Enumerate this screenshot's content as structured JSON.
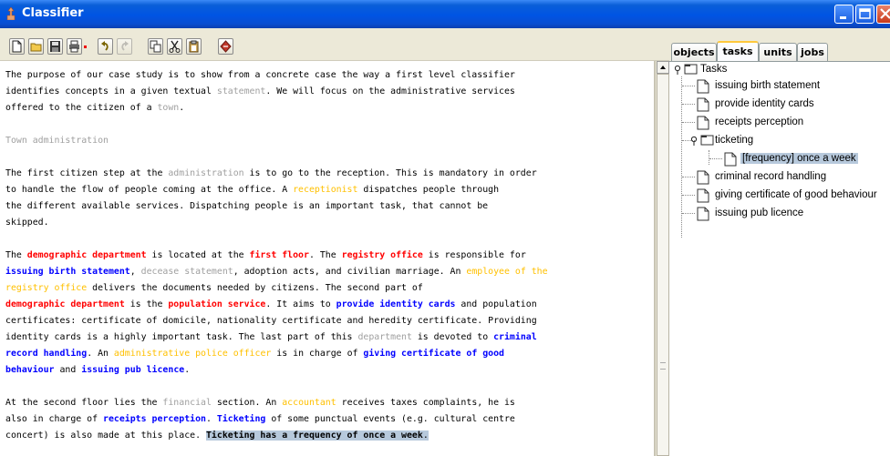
{
  "window": {
    "title": "Classifier"
  },
  "tabs": [
    {
      "label": "objects"
    },
    {
      "label": "tasks"
    },
    {
      "label": "units"
    },
    {
      "label": "jobs"
    }
  ],
  "tree": {
    "root": "Tasks",
    "items": [
      "issuing birth statement",
      "provide identity cards",
      "receipts perception",
      "ticketing",
      "[frequency] once a week",
      "criminal record handling",
      "giving certificate of good behaviour",
      "issuing pub licence"
    ]
  },
  "text": {
    "p1_l1": "The purpose of our case study is to show from a concrete case the way a first level classifier",
    "p1_l2a": "identifies concepts in a given textual ",
    "p1_l2b": "statement",
    "p1_l2c": ". We will focus on the administrative services",
    "p1_l3a": "offered to the citizen of a ",
    "p1_l3b": "town",
    "p1_l3c": ".",
    "heading": "Town administration",
    "p2_l1a": "The first citizen step at the ",
    "p2_l1b": "administration",
    "p2_l1c": " is to go to the reception. This is mandatory in order",
    "p2_l2a": "to handle the flow of people coming at the office. A ",
    "p2_l2b": "receptionist",
    "p2_l2c": " dispatches people through",
    "p2_l3": "the different available services. Dispatching people is an important task, that cannot be",
    "p2_l4": "skipped.",
    "p3_l1a": "The ",
    "p3_l1b": "demographic department",
    "p3_l1c": " is located at the ",
    "p3_l1d": "first floor",
    "p3_l1e": ". The ",
    "p3_l1f": "registry office",
    "p3_l1g": " is responsible for",
    "p3_l2a": "issuing birth statement",
    "p3_l2b": ", ",
    "p3_l2c": "decease statement",
    "p3_l2d": ", adoption acts, and civilian marriage. An ",
    "p3_l2e": "employee of the",
    "p3_l3a": "registry office",
    "p3_l3b": " delivers the documents needed by citizens. The second part of",
    "p3_l4a": "demographic department",
    "p3_l4b": " is the ",
    "p3_l4c": "population service",
    "p3_l4d": ". It aims to ",
    "p3_l4e": "provide identity cards",
    "p3_l4f": " and population",
    "p3_l5": "certificates: certificate of domicile, nationality certificate and heredity certificate. Providing",
    "p3_l6a": "identity cards is a highly important task. The last part of this ",
    "p3_l6b": "department",
    "p3_l6c": " is devoted to ",
    "p3_l6d": "criminal",
    "p3_l7a": "record handling",
    "p3_l7b": ". An ",
    "p3_l7c": "administrative police officer",
    "p3_l7d": " is in charge of ",
    "p3_l7e": "giving certificate of good",
    "p3_l8a": "behaviour",
    "p3_l8b": " and ",
    "p3_l8c": "issuing pub licence",
    "p3_l8d": ".",
    "p4_l1a": "At the second floor lies the ",
    "p4_l1b": "financial",
    "p4_l1c": " section. An ",
    "p4_l1d": "accountant",
    "p4_l1e": " receives taxes complaints, he is",
    "p4_l2a": "also in charge of ",
    "p4_l2b": "receipts perception",
    "p4_l2c": ". ",
    "p4_l2d": "Ticketing",
    "p4_l2e": " of some punctual events (e.g. cultural centre",
    "p4_l3a": "concert) is also made at this place. ",
    "p4_l3b": "Ticketing has a frequency of ",
    "p4_l3c": "once a week",
    "p4_l3d": "."
  },
  "colors": {
    "titlebar": "#0054e3",
    "concept_red": "#ff0000",
    "concept_blue": "#0000ff",
    "concept_orange": "#ffc000",
    "concept_gray": "#a0a0a0",
    "selection": "#b7c9dc"
  },
  "icons": {
    "toolbar": [
      "new-file-icon",
      "open-folder-icon",
      "save-icon",
      "print-icon",
      "undo-icon",
      "redo-icon",
      "copy-icon",
      "cut-icon",
      "paste-icon",
      "classify-icon"
    ]
  }
}
